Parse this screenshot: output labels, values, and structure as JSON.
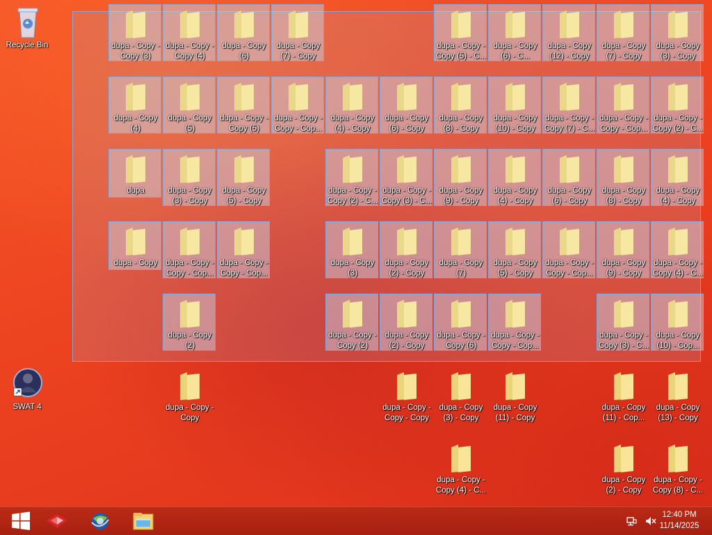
{
  "desktop": {
    "system_icons": {
      "recycle_bin": "Recycle Bin",
      "swat4": "SWAT 4"
    },
    "row1": [
      "dupa - Copy - Copy (3)",
      "dupa - Copy - Copy (4)",
      "dupa - Copy (6)",
      "dupa - Copy (7) - Copy",
      "dupa - Copy - Copy (5) - C...",
      "dupa - Copy (6) - C...",
      "dupa - Copy (12) - Copy",
      "dupa - Copy (7) - Copy",
      "dupa - Copy (3) - Copy"
    ],
    "row2": [
      "dupa - Copy (4)",
      "dupa - Copy (5)",
      "dupa - Copy - Copy (5)",
      "dupa - Copy - Copy - Cop...",
      "dupa - Copy (4) - Copy",
      "dupa - Copy (6) - Copy",
      "dupa - Copy (8) - Copy",
      "dupa - Copy (10) - Copy",
      "dupa - Copy - Copy (7) - C...",
      "dupa - Copy - Copy - Cop...",
      "dupa - Copy - Copy (2) - C..."
    ],
    "row3": [
      "dupa",
      "dupa - Copy (3) - Copy",
      "dupa - Copy (5) - Copy",
      "dupa - Copy - Copy (2) - C...",
      "dupa - Copy - Copy (3) - C...",
      "dupa - Copy (9) - Copy",
      "dupa - Copy (4) - Copy",
      "dupa - Copy (6) - Copy",
      "dupa - Copy (8) - Copy",
      "dupa - Copy (4) - Copy"
    ],
    "row4": [
      "dupa - Copy",
      "dupa - Copy - Copy - Cop...",
      "dupa - Copy - Copy - Cop...",
      "dupa - Copy (3)",
      "dupa - Copy (2) - Copy",
      "dupa - Copy (7)",
      "dupa - Copy (5) - Copy",
      "dupa - Copy - Copy - Cop...",
      "dupa - Copy (9) - Copy",
      "dupa - Copy - Copy (4) - C..."
    ],
    "row5": [
      "dupa - Copy (2)",
      "dupa - Copy - Copy (2)",
      "dupa - Copy (2) - Copy",
      "dupa - Copy - Copy (6)",
      "dupa - Copy - Copy - Cop...",
      "dupa - Copy - Copy (3) - C...",
      "dupa - Copy (10) - Cop..."
    ],
    "row6": [
      "dupa - Copy - Copy",
      "dupa - Copy - Copy - Copy",
      "dupa - Copy (3) - Copy",
      "dupa - Copy (11) - Copy",
      "dupa - Copy (11) - Cop...",
      "dupa - Copy (13) - Copy"
    ],
    "row7": [
      "dupa - Copy - Copy (4) - C...",
      "dupa - Copy (2) - Copy",
      "dupa - Copy - Copy (8) - C..."
    ]
  },
  "taskbar": {
    "time": "12:40 PM",
    "date": "11/14/2025",
    "icons": [
      "start-icon",
      "app-icon",
      "browser-icon",
      "file-explorer-icon"
    ]
  }
}
